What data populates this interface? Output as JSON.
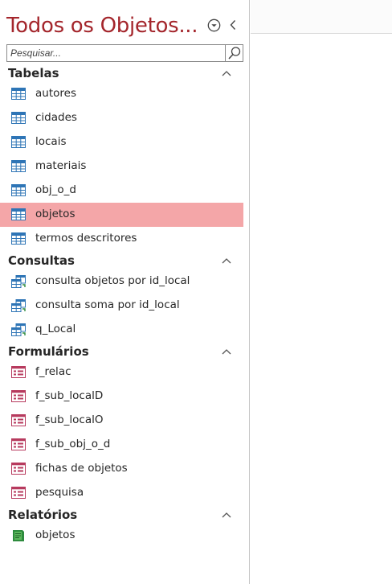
{
  "pane": {
    "title": "Todos os Objetos...",
    "search_placeholder": "Pesquisar..."
  },
  "groups": [
    {
      "id": "tabelas",
      "label": "Tabelas",
      "icon": "table-icon",
      "items": [
        "autores",
        "cidades",
        "locais",
        "materiais",
        "obj_o_d",
        "objetos",
        "termos descritores"
      ],
      "selected": "objetos"
    },
    {
      "id": "consultas",
      "label": "Consultas",
      "icon": "query-icon",
      "items": [
        "consulta objetos por id_local",
        "consulta soma por id_local",
        "q_Local"
      ]
    },
    {
      "id": "formularios",
      "label": "Formulários",
      "icon": "form-icon",
      "items": [
        "f_relac",
        "f_sub_localD",
        "f_sub_localO",
        "f_sub_obj_o_d",
        "fichas de objetos",
        "pesquisa"
      ]
    },
    {
      "id": "relatorios",
      "label": "Relatórios",
      "icon": "report-icon",
      "items": [
        "objetos"
      ]
    }
  ],
  "colors": {
    "title": "#a4262c",
    "selected_bg": "#f4a6a8",
    "table_icon": "#2e75b6",
    "form_icon": "#b73a5e",
    "report_icon": "#2e8b3e"
  }
}
